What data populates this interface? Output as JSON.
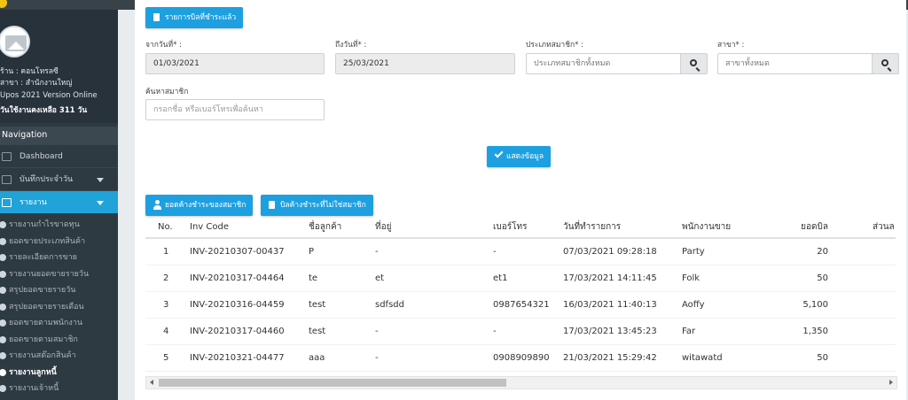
{
  "sidebar": {
    "profile": {
      "shop": "ร้าน : คอนโทรลซี",
      "branch": "สาขา : สำนักงานใหญ่",
      "version": "Upos 2021 Version Online",
      "remaining": "วันใช้งานคงเหลือ 311 วัน"
    },
    "nav_header": "Navigation",
    "items": [
      {
        "label": "Dashboard"
      },
      {
        "label": "บันทึกประจำวัน"
      },
      {
        "label": "รายงาน"
      }
    ],
    "sub_items": [
      "รายงานกำไรขาดทุน",
      "ยอดขายประเภทสินค้า",
      "รายละเอียดการขาย",
      "รายงานยอดขายรายวัน",
      "สรุปยอดขายรายวัน",
      "สรุปยอดขายรายเดือน",
      "ยอดขายตามพนักงาน",
      "ยอดขายตามสมาชิก",
      "รายงานสต๊อกสินค้า",
      "รายงานลูกหนี้",
      "รายงานเจ้าหนี้"
    ]
  },
  "main": {
    "paid_bills_button": "รายการบิลที่ชำระแล้ว",
    "filters": {
      "from_label": "จากวันที่* :",
      "from_value": "01/03/2021",
      "to_label": "ถึงวันที่* :",
      "to_value": "25/03/2021",
      "member_type_label": "ประเภทสมาชิก* :",
      "member_type_value": "ประเภทสมาชิกทั้งหมด",
      "branch_label": "สาขา* :",
      "branch_value": "สาขาทั้งหมด",
      "search_member_label": "ค้นหาสมาชิก",
      "search_member_placeholder": "กรอกชื่อ หรือเบอร์โทรเพื่อค้นหา"
    },
    "show_button": "แสดงข้อมูล",
    "member_debt_button": "ยอดค้างชำระของสมาชิก",
    "nonmember_debt_button": "บิลค้างชำระที่ไม่ใช่สมาชิก",
    "table": {
      "headers": [
        "No.",
        "Inv Code",
        "ชื่อลูกค้า",
        "ที่อยู่",
        "เบอร์โทร",
        "วันที่ทำรายการ",
        "พนักงานขาย",
        "ยอดบิล",
        "ส่วนล"
      ],
      "rows": [
        [
          "1",
          "INV-20210307-00437",
          "P",
          "-",
          "-",
          "07/03/2021 09:28:18",
          "Party",
          "20",
          ""
        ],
        [
          "2",
          "INV-20210317-04464",
          "te",
          "et",
          "et1",
          "17/03/2021 14:11:45",
          "Folk",
          "50",
          ""
        ],
        [
          "3",
          "INV-20210316-04459",
          "test",
          "sdfsdd",
          "0987654321",
          "16/03/2021 11:40:13",
          "Aoffy",
          "5,100",
          ""
        ],
        [
          "4",
          "INV-20210317-04460",
          "test",
          "-",
          "-",
          "17/03/2021 13:45:23",
          "Far",
          "1,350",
          ""
        ],
        [
          "5",
          "INV-20210321-04477",
          "aaa",
          "-",
          "0908909890",
          "21/03/2021 15:29:42",
          "witawatd",
          "50",
          ""
        ]
      ]
    }
  }
}
